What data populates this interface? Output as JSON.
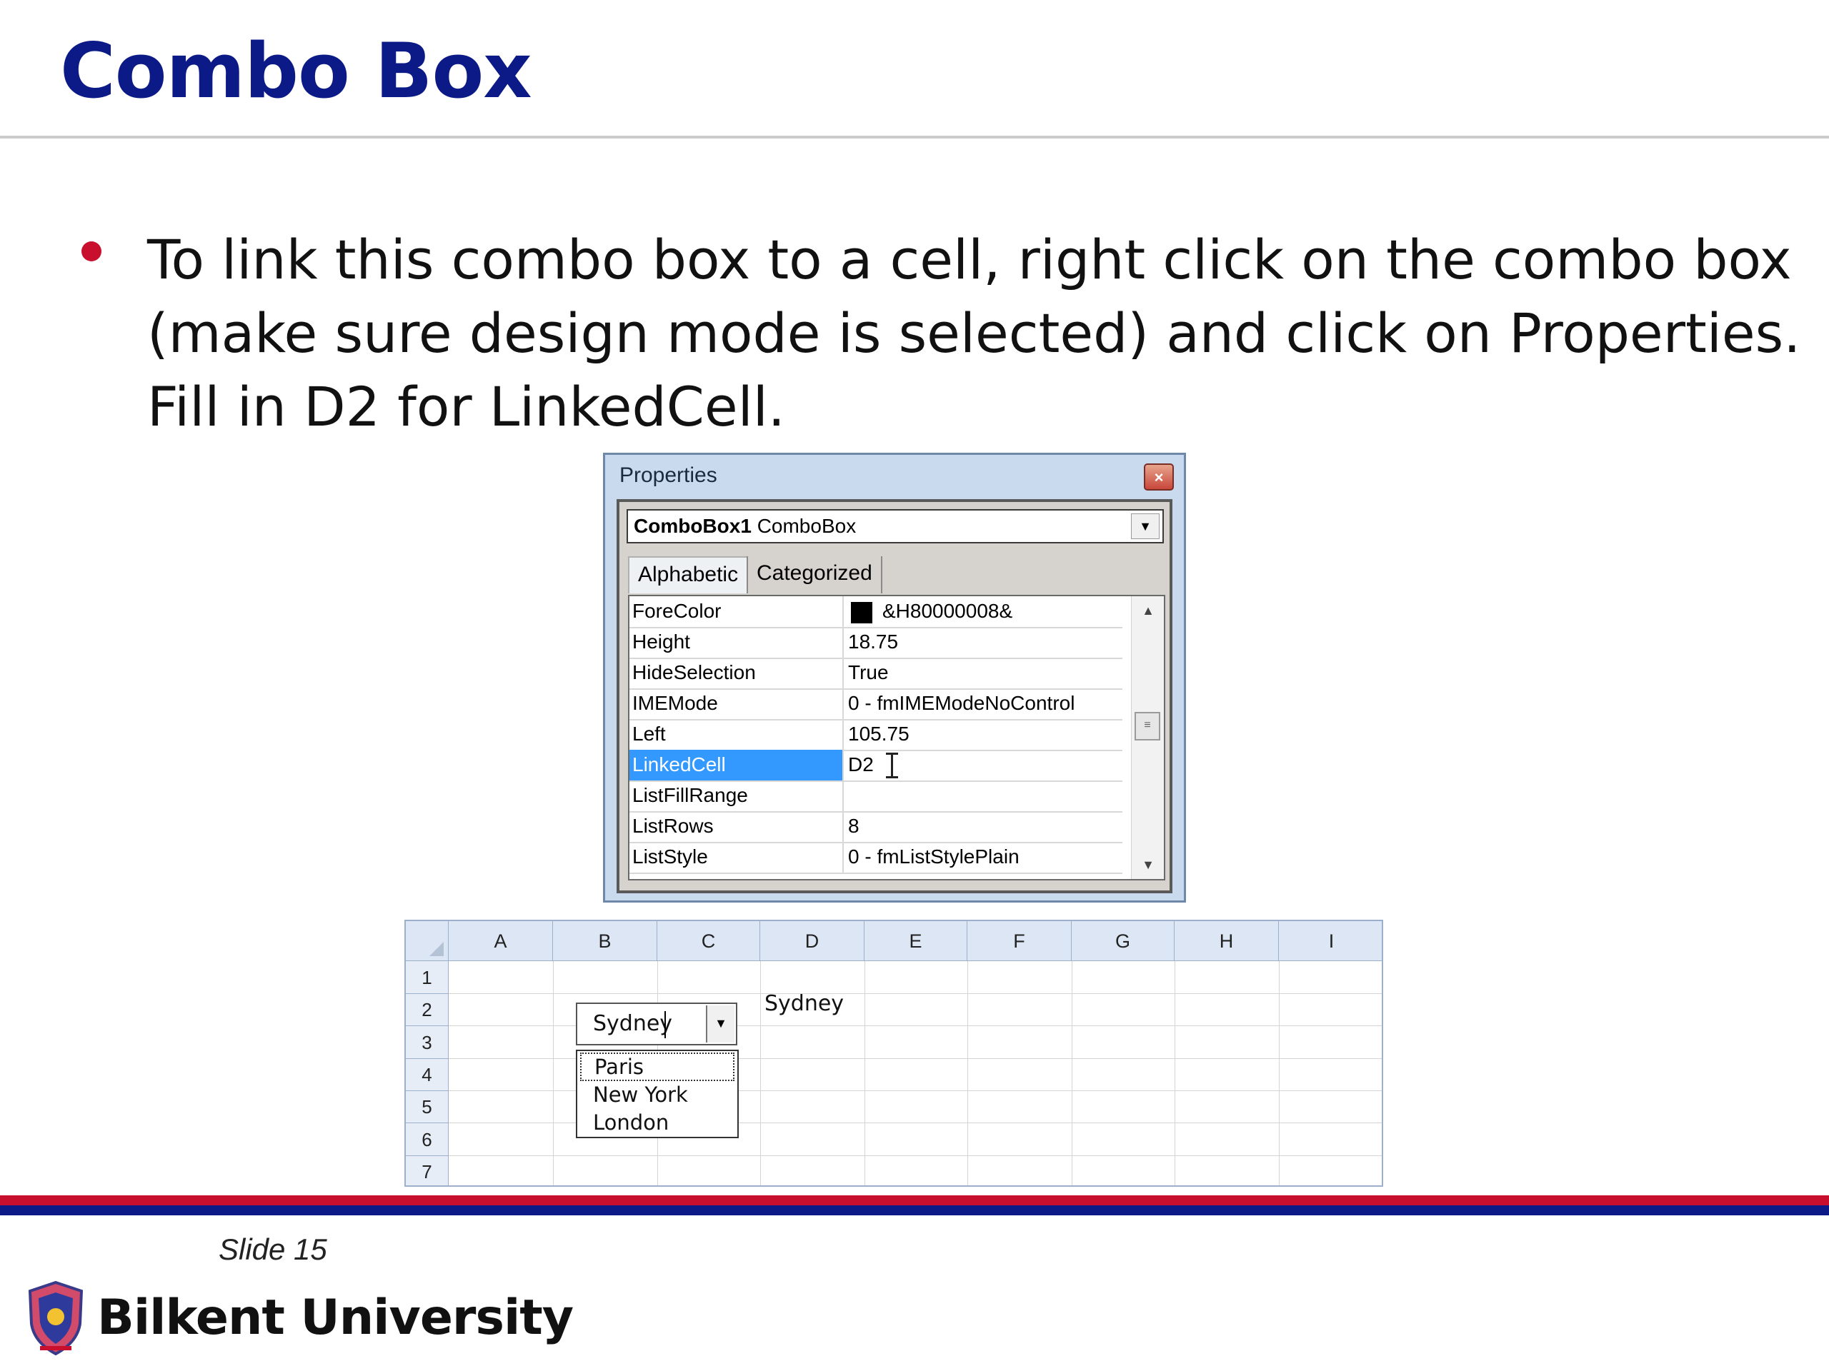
{
  "slide": {
    "title": "Combo Box",
    "bullet_lines": [
      "To link this combo box to a cell, right click on the combo box",
      "(make sure design mode is selected) and click on Properties.",
      "Fill in D2 for LinkedCell."
    ],
    "slide_number": "Slide 15",
    "university": "Bilkent University"
  },
  "properties": {
    "title": "Properties",
    "close_glyph": "×",
    "object_name": "ComboBox1",
    "object_type": "ComboBox",
    "tabs": [
      "Alphabetic",
      "Categorized"
    ],
    "rows": [
      {
        "name": "ForeColor",
        "value": "&H80000008&"
      },
      {
        "name": "Height",
        "value": "18.75"
      },
      {
        "name": "HideSelection",
        "value": "True"
      },
      {
        "name": "IMEMode",
        "value": "0 - fmIMEModeNoControl"
      },
      {
        "name": "Left",
        "value": "105.75"
      },
      {
        "name": "LinkedCell",
        "value": "D2"
      },
      {
        "name": "ListFillRange",
        "value": ""
      },
      {
        "name": "ListRows",
        "value": "8"
      },
      {
        "name": "ListStyle",
        "value": "0 - fmListStylePlain"
      }
    ],
    "forecolor_swatch": "#000000"
  },
  "spreadsheet": {
    "columns": [
      "A",
      "B",
      "C",
      "D",
      "E",
      "F",
      "G",
      "H",
      "I"
    ],
    "rows": [
      "1",
      "2",
      "3",
      "4",
      "5",
      "6",
      "7"
    ],
    "cell_d2": "Sydney",
    "combo_value": "Sydney",
    "combo_options": [
      "Paris",
      "New York",
      "London"
    ]
  },
  "colors": {
    "title": "#0b1a86",
    "bullet": "#c8102e",
    "selection": "#3399ff",
    "footer_red": "#c8102e",
    "footer_blue": "#0b1a86"
  }
}
